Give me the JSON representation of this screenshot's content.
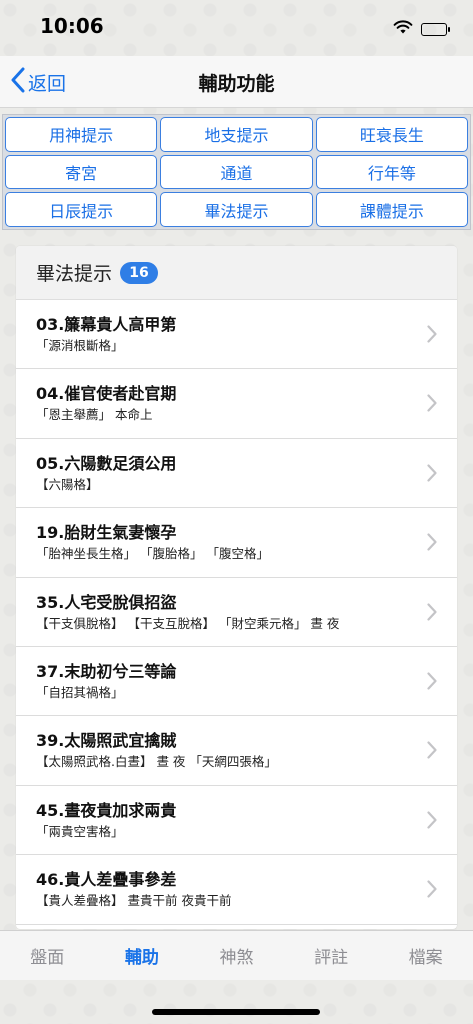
{
  "status": {
    "time": "10:06"
  },
  "nav": {
    "back_label": "返回",
    "title": "輔助功能"
  },
  "grid": [
    {
      "label": "用神提示"
    },
    {
      "label": "地支提示"
    },
    {
      "label": "旺衰長生"
    },
    {
      "label": "寄宮"
    },
    {
      "label": "通道"
    },
    {
      "label": "行年等"
    },
    {
      "label": "日辰提示"
    },
    {
      "label": "畢法提示"
    },
    {
      "label": "課體提示"
    }
  ],
  "list": {
    "title": "畢法提示",
    "count": "16",
    "items": [
      {
        "title": "03.簾幕貴人高甲第",
        "sub": "「源消根斷格」"
      },
      {
        "title": "04.催官使者赴官期",
        "sub": "「恩主舉薦」 本命上"
      },
      {
        "title": "05.六陽數足須公用",
        "sub": "【六陽格】"
      },
      {
        "title": "19.胎財生氣妻懷孕",
        "sub": "「胎神坐長生格」 「腹胎格」 「腹空格」"
      },
      {
        "title": "35.人宅受脫俱招盜",
        "sub": "【干支俱脫格】 【干支互脫格】 「財空乘元格」 晝 夜"
      },
      {
        "title": "37.末助初兮三等論",
        "sub": "「自招其禍格」"
      },
      {
        "title": "39.太陽照武宜擒賊",
        "sub": "【太陽照武格.白晝】 晝 夜 「天網四張格」"
      },
      {
        "title": "45.晝夜貴加求兩貴",
        "sub": "「兩貴空害格」"
      },
      {
        "title": "46.貴人差疊事參差",
        "sub": "【貴人差疊格】 晝貴干前 夜貴干前"
      }
    ]
  },
  "tabs": [
    {
      "label": "盤面"
    },
    {
      "label": "輔助"
    },
    {
      "label": "神煞"
    },
    {
      "label": "評註"
    },
    {
      "label": "檔案"
    }
  ],
  "colors": {
    "accent": "#1a73e8",
    "badge": "#2f7ee6",
    "inactive_tab": "#8e8e93"
  },
  "active_tab": "輔助"
}
